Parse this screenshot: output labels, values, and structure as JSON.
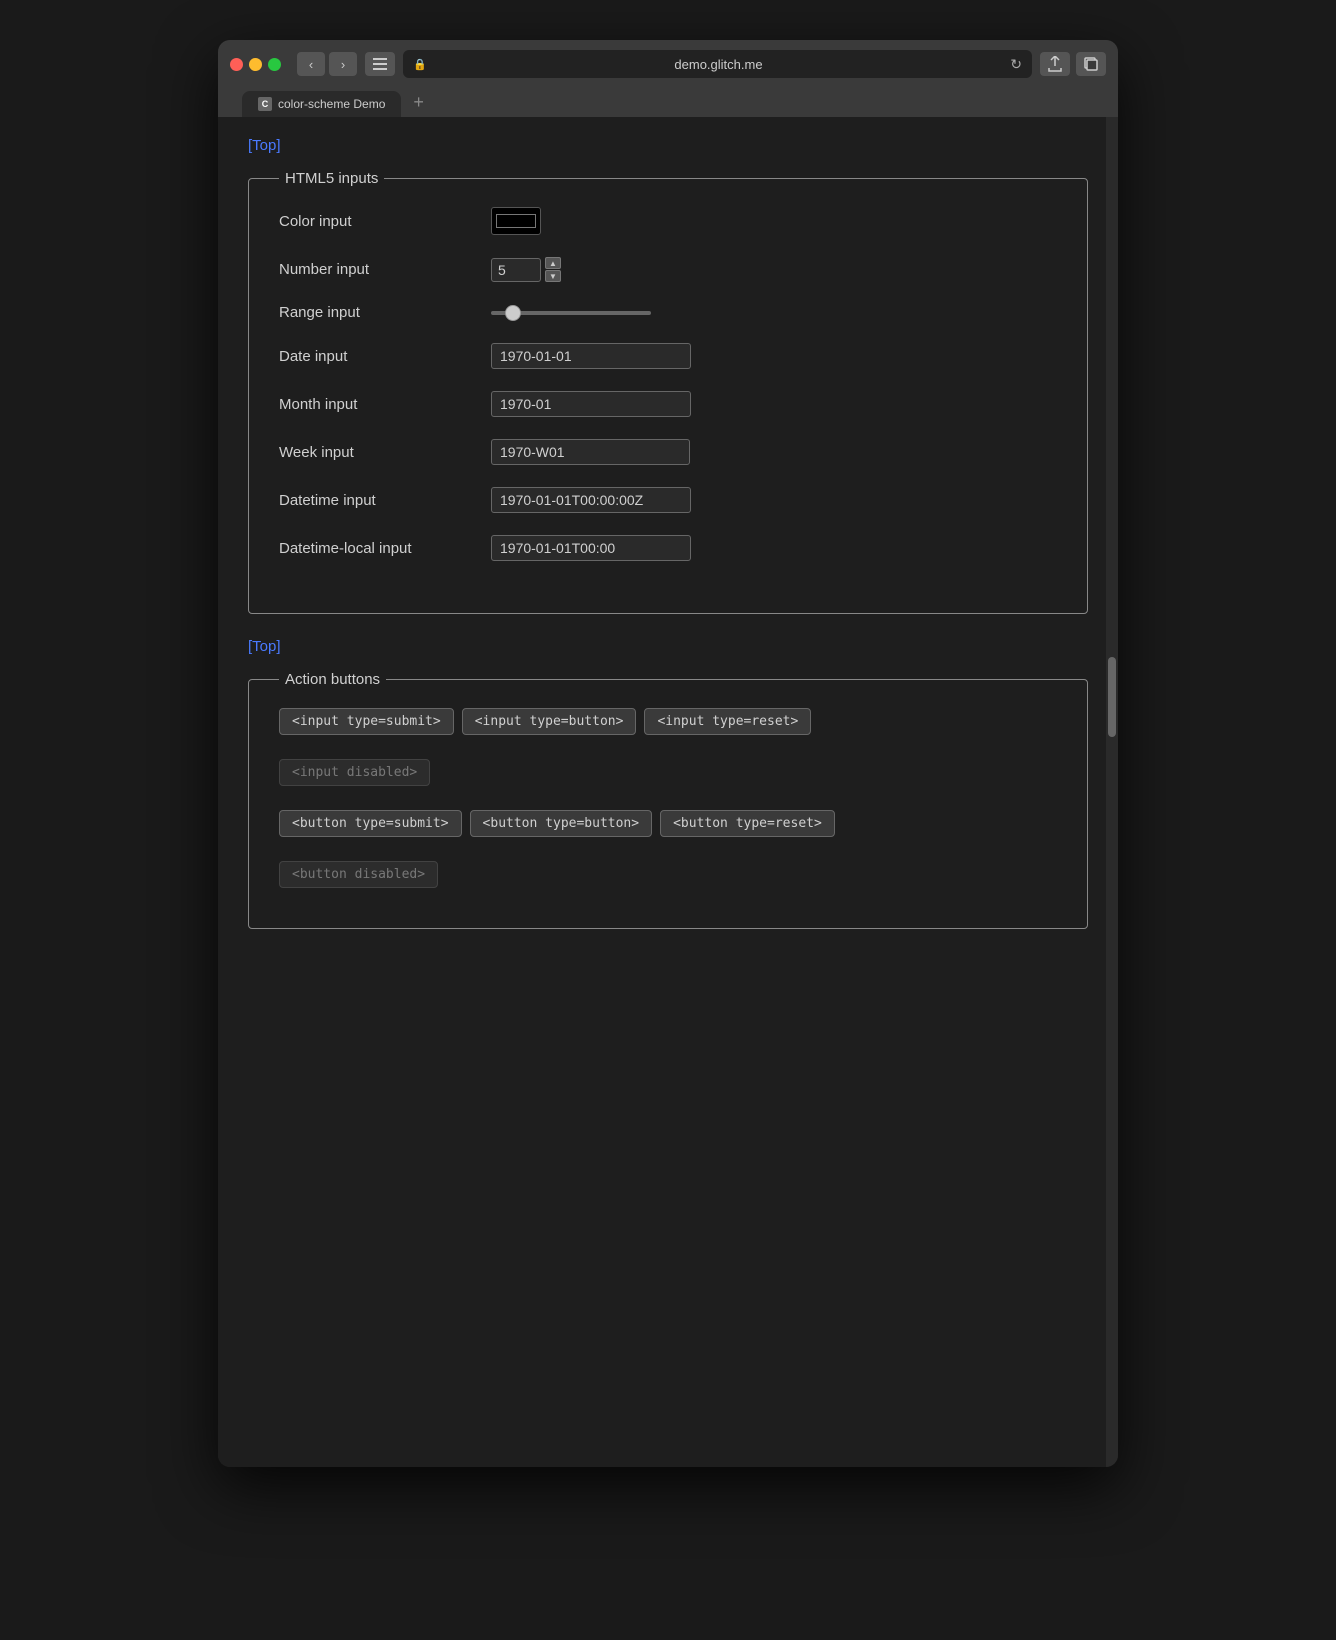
{
  "browser": {
    "url": "demo.glitch.me",
    "tab_label": "color-scheme Demo",
    "tab_favicon": "C"
  },
  "page": {
    "top_link": "[Top]",
    "html5_section": {
      "legend": "HTML5 inputs",
      "fields": [
        {
          "label": "Color input",
          "type": "color",
          "value": "#000000"
        },
        {
          "label": "Number input",
          "type": "number",
          "value": "5"
        },
        {
          "label": "Range input",
          "type": "range",
          "value": "10"
        },
        {
          "label": "Date input",
          "type": "date",
          "value": "1970-01-01"
        },
        {
          "label": "Month input",
          "type": "month",
          "value": "1970-01"
        },
        {
          "label": "Week input",
          "type": "week",
          "value": "1970-W01"
        },
        {
          "label": "Datetime input",
          "type": "datetime",
          "value": "1970-01-01T00:00:00Z"
        },
        {
          "label": "Datetime-local input",
          "type": "datetime-local",
          "value": "1970-01-01T00:00"
        }
      ]
    },
    "bottom_top_link": "[Top]",
    "action_section": {
      "legend": "Action buttons",
      "input_buttons": [
        {
          "label": "<input type=submit>",
          "disabled": false
        },
        {
          "label": "<input type=button>",
          "disabled": false
        },
        {
          "label": "<input type=reset>",
          "disabled": false
        },
        {
          "label": "<input disabled>",
          "disabled": true
        }
      ],
      "button_buttons": [
        {
          "label": "<button type=submit>",
          "disabled": false
        },
        {
          "label": "<button type=button>",
          "disabled": false
        },
        {
          "label": "<button type=reset>",
          "disabled": false
        },
        {
          "label": "<button disabled>",
          "disabled": true
        }
      ]
    }
  }
}
